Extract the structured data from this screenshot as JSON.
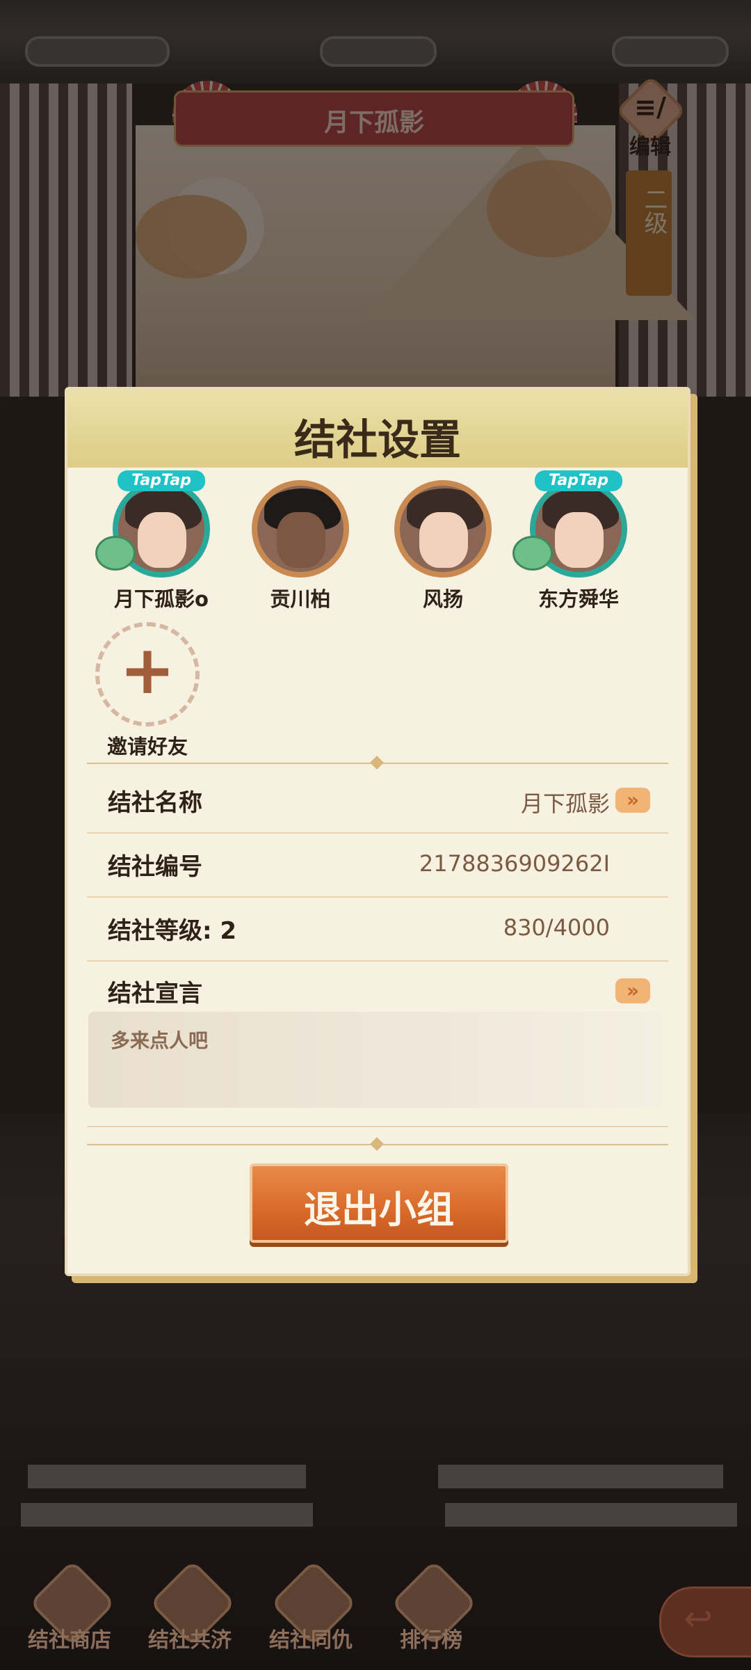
{
  "scene": {
    "banner_title": "月下孤影",
    "edit_label": "编辑",
    "edit_glyph": "≡/",
    "level_tag": "二级"
  },
  "modal": {
    "title": "结社设置",
    "members": [
      {
        "name": "月下孤影o",
        "badge": "TapTap",
        "frame": "teal",
        "has_jade": true
      },
      {
        "name": "贡川柏",
        "badge": "",
        "frame": "bronze",
        "has_jade": false
      },
      {
        "name": "风扬",
        "badge": "",
        "frame": "bronze",
        "has_jade": false
      },
      {
        "name": "东方舜华",
        "badge": "TapTap",
        "frame": "teal",
        "has_jade": true
      }
    ],
    "invite": {
      "icon": "+",
      "label": "邀请好友"
    },
    "rows": {
      "name": {
        "label": "结社名称",
        "value": "月下孤影"
      },
      "id": {
        "label": "结社编号",
        "value": "2178836909262I"
      },
      "level": {
        "label": "结社等级: 2",
        "value": "830/4000"
      },
      "declaration": {
        "label": "结社宣言",
        "value": "多来点人吧"
      }
    },
    "quit_button": "退出小组"
  },
  "bottom_nav": [
    {
      "label": "结社商店",
      "icon": "shop-icon"
    },
    {
      "label": "结社共济",
      "icon": "scroll-icon"
    },
    {
      "label": "结社同仇",
      "icon": "sword-icon"
    },
    {
      "label": "排行榜",
      "icon": "ranking-icon"
    }
  ],
  "back_icon": "↩",
  "chevron": "»",
  "colors": {
    "accent": "#d96a2a",
    "teal": "#2aa89a",
    "bronze": "#c98a52"
  }
}
